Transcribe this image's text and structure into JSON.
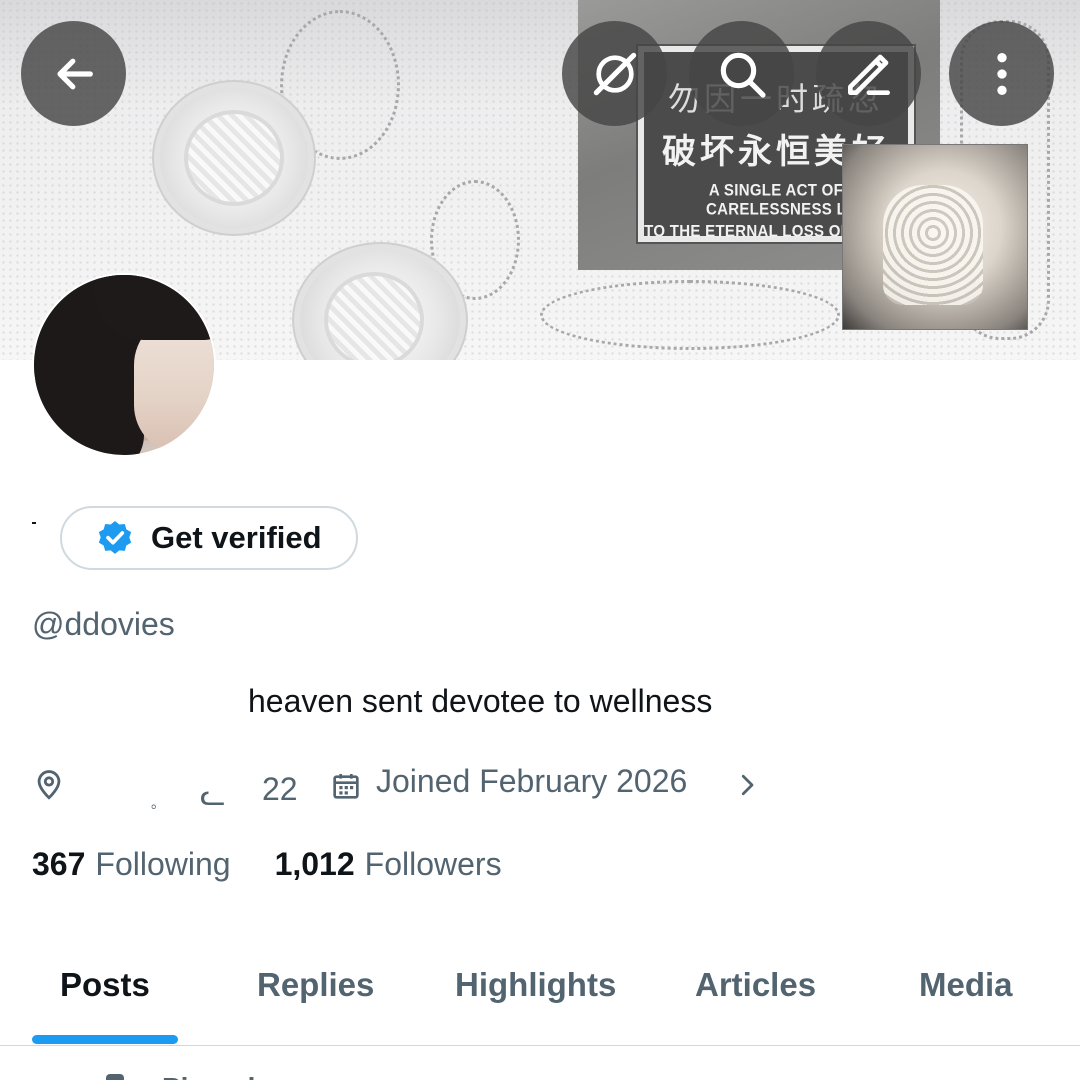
{
  "banner": {
    "sign_cn_line1": "勿因一时疏忽",
    "sign_cn_line2": "破坏永恒美好",
    "sign_en_line1": "A SINGLE ACT OF CARELESSNESS L",
    "sign_en_line2": "TO THE ETERNAL LOSS OF BEAUT"
  },
  "top_bar": {
    "icons": [
      "back-arrow-icon",
      "grok-icon",
      "search-icon",
      "edit-icon",
      "more-vertical-icon"
    ]
  },
  "verify": {
    "label": "Get verified",
    "badge_color": "#1d9bf0"
  },
  "profile": {
    "handle": "@ddovies",
    "bio": "heaven sent devotee to wellness",
    "location_glyph_1": "。",
    "location_glyph_2": "ᓚ",
    "location_text": "22",
    "joined": "Joined February 2026",
    "following_count": "367",
    "following_label": "Following",
    "followers_count": "1,012",
    "followers_label": "Followers"
  },
  "tabs": [
    {
      "label": "Posts",
      "active": true
    },
    {
      "label": "Replies",
      "active": false
    },
    {
      "label": "Highlights",
      "active": false
    },
    {
      "label": "Articles",
      "active": false
    },
    {
      "label": "Media",
      "active": false
    }
  ],
  "pinned": {
    "label": "Pinned"
  },
  "colors": {
    "accent": "#1d9bf0",
    "text_primary": "#0f1419",
    "text_secondary": "#536471",
    "border": "#cfd9de"
  }
}
